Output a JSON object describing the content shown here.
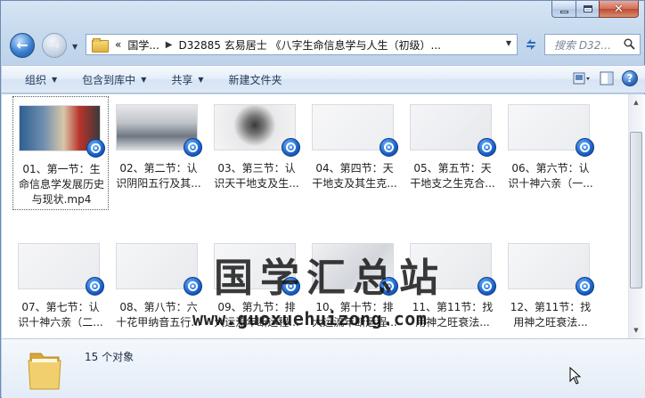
{
  "address": {
    "crumbs": [
      "«",
      "国学...",
      "D32885 玄易居士 《八字生命信息学与人生（初级）..."
    ]
  },
  "search": {
    "placeholder": "搜索 D32..."
  },
  "toolbar": {
    "organize": "组织",
    "include_in_library": "包含到库中",
    "share": "共享",
    "new_folder": "新建文件夹"
  },
  "files": [
    {
      "line1": "01、第一节：生",
      "line2": "命信息学发展历史",
      "line3": "与现状.mp4",
      "selected": true
    },
    {
      "line1": "02、第二节：认",
      "line2": "识阴阳五行及其...",
      "line3": ""
    },
    {
      "line1": "03、第三节：认",
      "line2": "识天干地支及生...",
      "line3": ""
    },
    {
      "line1": "04、第四节：天",
      "line2": "干地支及其生克...",
      "line3": ""
    },
    {
      "line1": "05、第五节：天",
      "line2": "干地支之生克合...",
      "line3": ""
    },
    {
      "line1": "06、第六节：认",
      "line2": "识十神六亲（一...",
      "line3": ""
    },
    {
      "line1": "07、第七节：认",
      "line2": "识十神六亲（二...",
      "line3": ""
    },
    {
      "line1": "08、第八节：六",
      "line2": "十花甲纳音五行...",
      "line3": ""
    },
    {
      "line1": "09、第九节：排",
      "line2": "大运流年断运程...",
      "line3": ""
    },
    {
      "line1": "10、第十节：排",
      "line2": "大运流年断运程...",
      "line3": ""
    },
    {
      "line1": "11、第11节：找",
      "line2": "用神之旺衰法...",
      "line3": ""
    },
    {
      "line1": "12、第11节：找",
      "line2": "用神之旺衰法...",
      "line3": ""
    }
  ],
  "status": {
    "count": "15 个对象"
  },
  "watermark": {
    "cn": "国学汇总站",
    "url": "www.guoxuehuizong.com"
  },
  "icons": {
    "back": "back-arrow-icon",
    "forward": "forward-arrow-icon",
    "folder": "folder-icon",
    "refresh": "refresh-icon",
    "search": "search-icon",
    "help": "help-icon",
    "video_badge": "video-file-icon"
  }
}
